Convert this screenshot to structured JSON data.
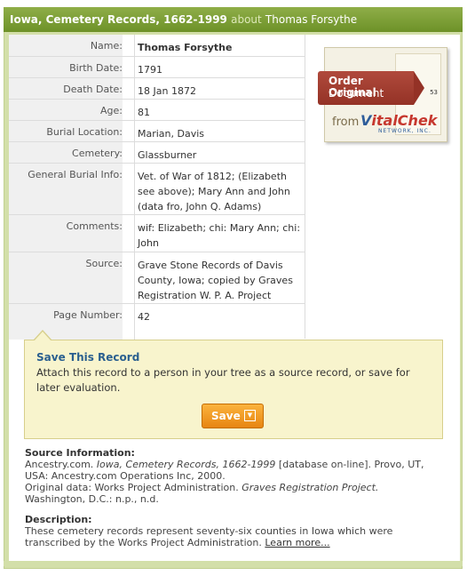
{
  "header": {
    "collection": "Iowa, Cemetery Records, 1662-1999",
    "about": "about",
    "person": "Thomas Forsythe"
  },
  "record": [
    {
      "label": "Name:",
      "value": "Thomas Forsythe"
    },
    {
      "label": "Birth Date:",
      "value": "1791"
    },
    {
      "label": "Death Date:",
      "value": "18 Jan 1872"
    },
    {
      "label": "Age:",
      "value": "81"
    },
    {
      "label": "Burial Location:",
      "value": "Marian, Davis"
    },
    {
      "label": "Cemetery:",
      "value": "Glassburner"
    },
    {
      "label": "General Burial Info:",
      "value": "Vet. of War of 1812; (Elizabeth see above); Mary Ann and John (data fro, John Q. Adams)"
    },
    {
      "label": "Comments:",
      "value": "wif: Elizabeth; chi: Mary Ann; chi: John"
    },
    {
      "label": "Source:",
      "value": "Grave Stone Records of Davis County, Iowa; copied by Graves Registration W. P. A. Project"
    },
    {
      "label": "Page Number:",
      "value": "42"
    }
  ],
  "ad": {
    "line1": "Order Original",
    "line2": "Document",
    "from": "from",
    "brand_v": "V",
    "brand_rest": "italChek",
    "network": "NETWORK, INC.",
    "page_num": "53"
  },
  "save_panel": {
    "title": "Save This Record",
    "description": "Attach this record to a person in your tree as a source record, or save for later evaluation.",
    "button_label": "Save"
  },
  "source_info": {
    "heading": "Source Information:",
    "line1_a": "Ancestry.com. ",
    "line1_i": "Iowa, Cemetery Records, 1662-1999",
    "line1_b": " [database on-line]. Provo, UT, USA: Ancestry.com Operations Inc, 2000.",
    "line2_a": "Original data: Works Project Administration. ",
    "line2_i": "Graves Registration Project.",
    "line3": "Washington, D.C.: n.p., n.d."
  },
  "description": {
    "heading": "Description:",
    "text": "These cemetery records represent seventy-six counties in Iowa which were transcribed by the Works Project Administration. ",
    "link": "Learn more..."
  },
  "colors": {
    "header_green": "#6d9128",
    "frame_green": "#d3dfa9",
    "save_orange": "#e78511",
    "save_title_blue": "#2a5f8f",
    "ad_red": "#943226"
  }
}
